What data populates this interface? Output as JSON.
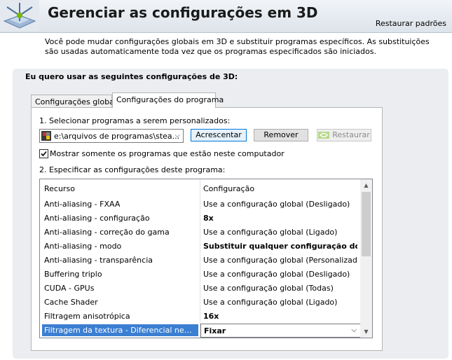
{
  "header": {
    "title": "Gerenciar as configurações em 3D",
    "restore_defaults": "Restaurar padrões"
  },
  "description": "Você pode mudar configurações globais em 3D e substituir programas específicos. As substituições são usadas automaticamente toda vez que os programas especificados são iniciados.",
  "panel": {
    "heading": "Eu quero usar as seguintes configurações de 3D:",
    "tabs": [
      {
        "label": "Configurações globais",
        "active": false
      },
      {
        "label": "Configurações do programa",
        "active": true
      }
    ],
    "step1_label": "1. Selecionar programas a serem personalizados:",
    "program_select_value": "e:\\arquivos de programas\\stea...",
    "buttons": {
      "add": "Acrescentar",
      "remove": "Remover",
      "restore": "Restaurar"
    },
    "checkbox": {
      "label": "Mostrar somente os programas que estão neste computador",
      "checked": true
    },
    "step2_label": "2. Especificar as configurações deste programa:",
    "grid": {
      "headers": [
        "Recurso",
        "Configuração"
      ],
      "rows": [
        {
          "resource": "Anti-aliasing - FXAA",
          "setting": "Use a configuração global (Desligado)",
          "bold": false
        },
        {
          "resource": "Anti-aliasing - configuração",
          "setting": "8x",
          "bold": true
        },
        {
          "resource": "Anti-aliasing - correção do gama",
          "setting": "Use a configuração global (Ligado)",
          "bold": false
        },
        {
          "resource": "Anti-aliasing - modo",
          "setting": "Substituir qualquer configuração do ...",
          "bold": true
        },
        {
          "resource": "Anti-aliasing - transparência",
          "setting": "Use a configuração global (Personalizado)",
          "bold": false
        },
        {
          "resource": "Buffering triplo",
          "setting": "Use a configuração global (Desligado)",
          "bold": false
        },
        {
          "resource": "CUDA - GPUs",
          "setting": "Use a configuração global (Todas)",
          "bold": false
        },
        {
          "resource": "Cache Shader",
          "setting": "Use a configuração global (Ligado)",
          "bold": false
        },
        {
          "resource": "Filtragem anisotrópica",
          "setting": "16x",
          "bold": true
        },
        {
          "resource": "Filtragem da textura - Diferencial negativo...",
          "setting": "Fixar",
          "bold": true,
          "selected": true
        }
      ]
    }
  },
  "colors": {
    "selection": "#3b7fd2",
    "panel_bg": "#ebedf0",
    "nvidia_green": "#76b900"
  }
}
